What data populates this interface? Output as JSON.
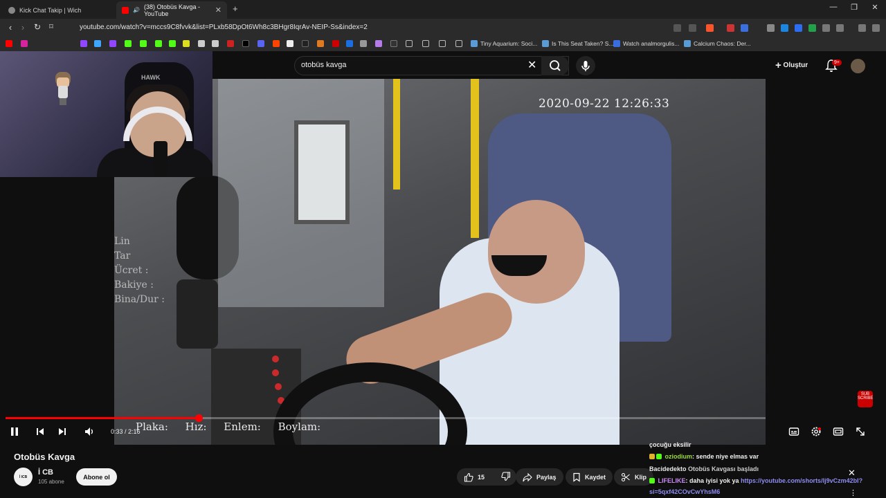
{
  "browser": {
    "tabs": [
      {
        "title": "Kick Chat Takip | Wich",
        "active": false
      },
      {
        "title": "(38) Otobüs Kavga - YouTube",
        "active": true
      }
    ],
    "new_tab_label": "+",
    "url": "youtube.com/watch?v=mccs9C8fvvk&list=PLxb58DpOt6Wh8c3BHgr8IqrAv-NEIP-Ss&index=2",
    "bookmarks": [
      "Tiny Aquarium: Soci...",
      "Is This Seat Taken? S...",
      "Watch analmorgulis...",
      "Calcium Chaos: Der..."
    ]
  },
  "youtube": {
    "search_value": "otobüs kavga",
    "create_label": "Oluştur",
    "notif_count": "9+",
    "video": {
      "timestamp_overlay": "2020-09-22 12:26:33",
      "osd_left": [
        "Lin",
        "Tar",
        "Ücret :",
        "Bakiye :",
        "Bina/Dur :"
      ],
      "osd_bottom": "Plaka: Hız: Enlem: Boylam:",
      "subscribe_tag": "SUB SCRIBE",
      "progress": 0.2538,
      "time_label": "0:33 / 2:16"
    },
    "title": "Otobüs Kavga",
    "channel": {
      "name": "İ CB",
      "subs": "105 abone",
      "avatar_text": "İ ICB"
    },
    "subscribe_label": "Abone ol",
    "actions": {
      "like_count": "15",
      "share": "Paylaş",
      "save": "Kaydet",
      "clip": "Klip"
    }
  },
  "chat": {
    "lines": [
      {
        "user": "",
        "text": "çocuğu eksilir"
      },
      {
        "user": "oziodium",
        "text": ": sende niye elmas var"
      },
      {
        "user": "Bacidedekto",
        "text": " Otobüs Kavgası başladı"
      },
      {
        "user": "LIFELIKE",
        "text": ": daha iyisi yok ya ",
        "link": "https://youtube.com/shorts/lj9vCzm42bI?"
      },
      {
        "user": "",
        "text": "",
        "link": "si=5qxf42COvCwYhsM6"
      }
    ]
  },
  "colors": {
    "accent": "#ff0000",
    "chat_user": "#9ddc3c",
    "link": "#8f8cf0"
  },
  "icons": [
    "back-icon",
    "forward-icon",
    "reload-icon",
    "bookmark-icon",
    "search-icon",
    "mic-icon",
    "bell-icon",
    "pause-icon",
    "prev-icon",
    "next-icon",
    "volume-icon",
    "captions-icon",
    "settings-icon",
    "miniplayer-icon",
    "fullscreen-icon",
    "like-icon",
    "dislike-icon",
    "share-icon",
    "save-icon",
    "scissors-icon",
    "close-icon",
    "more-icon"
  ]
}
